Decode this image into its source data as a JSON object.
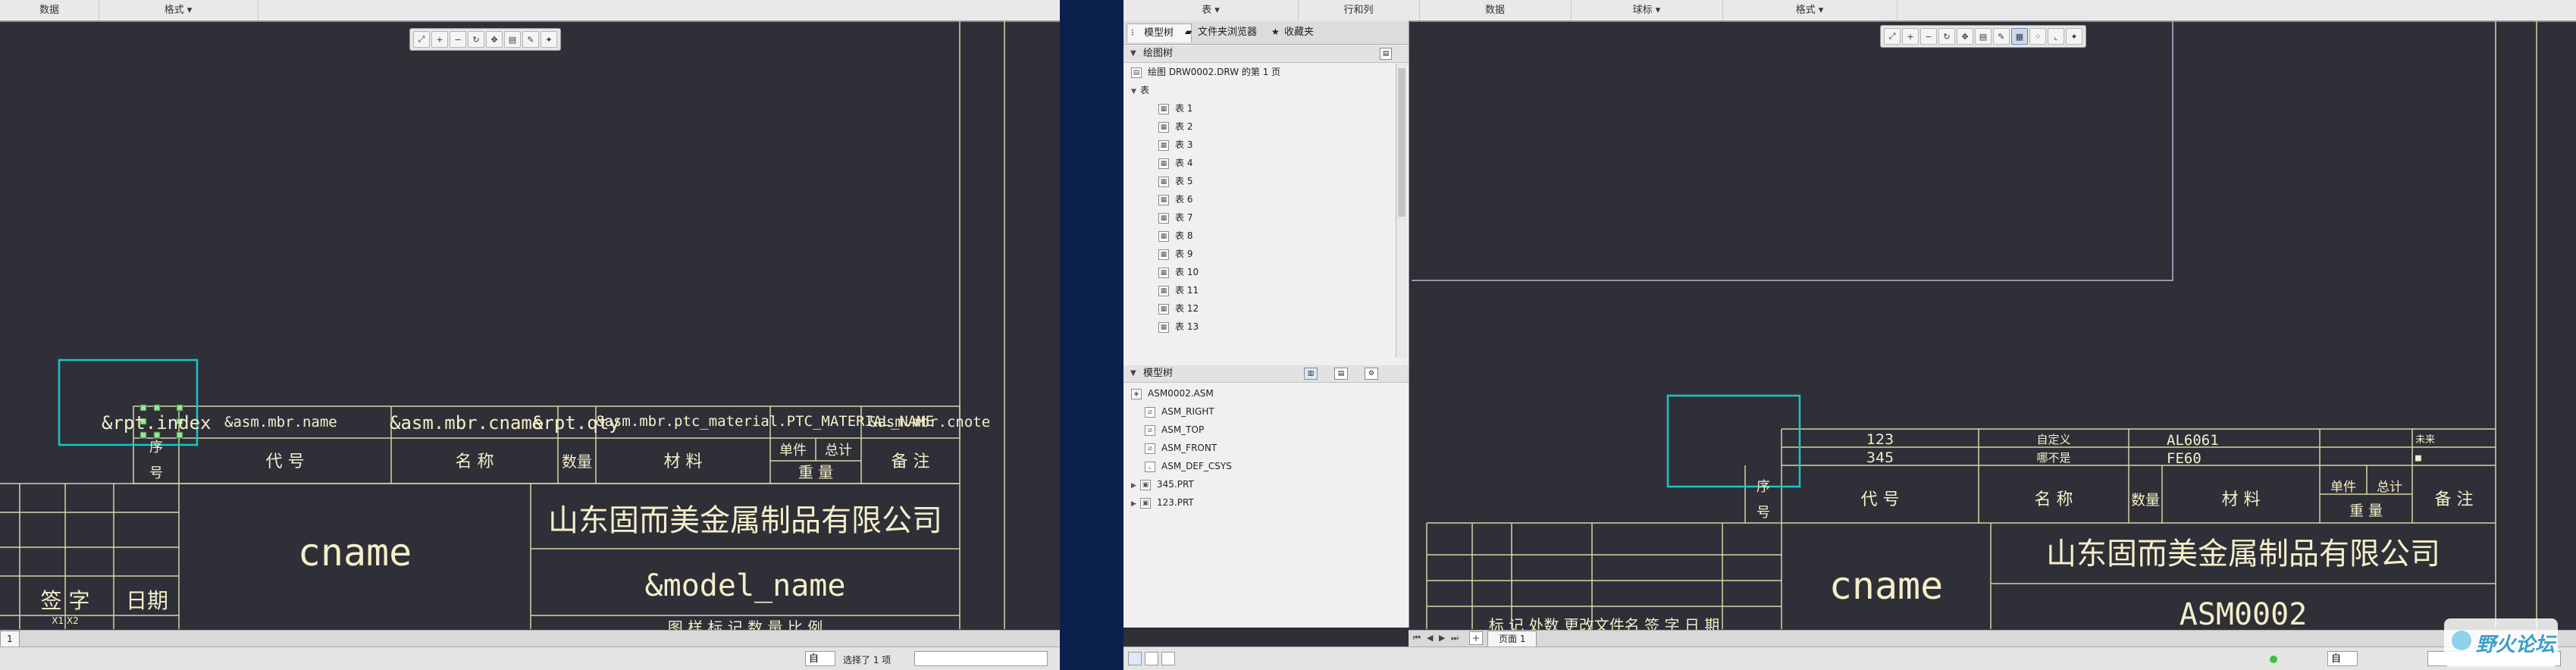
{
  "left_window": {
    "ribbon_tabs": [
      "数据",
      "格式 ▾"
    ],
    "drawing": {
      "repeat_row": {
        "index": "&rpt.index",
        "name": "&asm.mbr.name",
        "cname": "&asm.mbr.cname",
        "qty": "&rpt.qty",
        "material": "&asm.mbr.ptc_material.PTC_MATERIAL_NAME",
        "note": "&asm.mbr.cnote"
      },
      "header": {
        "seq_1": "序",
        "seq_2": "号",
        "code": "代 号",
        "name": "名 称",
        "qty": "数量",
        "material": "材 料",
        "unit_1": "单件",
        "unit_2": "总计",
        "weight": "重 量",
        "remarks": "备 注"
      },
      "cname": "cname",
      "company": "山东固而美金属制品有限公司",
      "model_name": "&model_name",
      "sign": "签 字",
      "date": "日期",
      "bottom_cut": "图 样 标 记    数 量    比 例",
      "small_marks": "X1  X2"
    },
    "page_tab": "1",
    "status": {
      "selected": "选择了 1 项",
      "combo": "自"
    }
  },
  "right_window": {
    "ribbon_tabs": [
      "表 ▾",
      "行和列",
      "数据",
      "球标 ▾",
      "格式 ▾"
    ],
    "panel_tabs": [
      "模型树",
      "文件夹浏览器",
      "收藏夹"
    ],
    "drawing_tree": {
      "title": "绘图树",
      "root": "绘图 DRW0002.DRW 的第 1 页",
      "tables_label": "表",
      "tables": [
        "表 1",
        "表 2",
        "表 3",
        "表 4",
        "表 5",
        "表 6",
        "表 7",
        "表 8",
        "表 9",
        "表 10",
        "表 11",
        "表 12",
        "表 13"
      ]
    },
    "model_tree": {
      "title": "模型树",
      "items": [
        "ASM0002.ASM",
        "ASM_RIGHT",
        "ASM_TOP",
        "ASM_FRONT",
        "ASM_DEF_CSYS",
        "345.PRT",
        "123.PRT"
      ]
    },
    "bom_rows": [
      {
        "code": "123",
        "name": "自定义",
        "material": "AL6061",
        "note": "未来"
      },
      {
        "code": "345",
        "name": "哪不是",
        "material": "FE60",
        "note": "■"
      }
    ],
    "header": {
      "seq_1": "序",
      "seq_2": "号",
      "code": "代 号",
      "name": "名 称",
      "qty": "数量",
      "material": "材 料",
      "unit_1": "单件",
      "unit_2": "总计",
      "weight": "重 量",
      "remarks": "备 注"
    },
    "cname": "cname",
    "company": "山东固而美金属制品有限公司",
    "model_name": "ASM0002",
    "bottom_cut": "标 记 处数  更改文件名    签  字    日 期",
    "page_tab": "页面 1",
    "status": {
      "combo": "自"
    }
  },
  "watermark": "野火论坛",
  "colors": {
    "canvas": "#2f2f38",
    "lines": "#d9d3a2",
    "text": "#f4efc8",
    "select": "#19c7c7",
    "desktop": "#0b1f4d"
  }
}
